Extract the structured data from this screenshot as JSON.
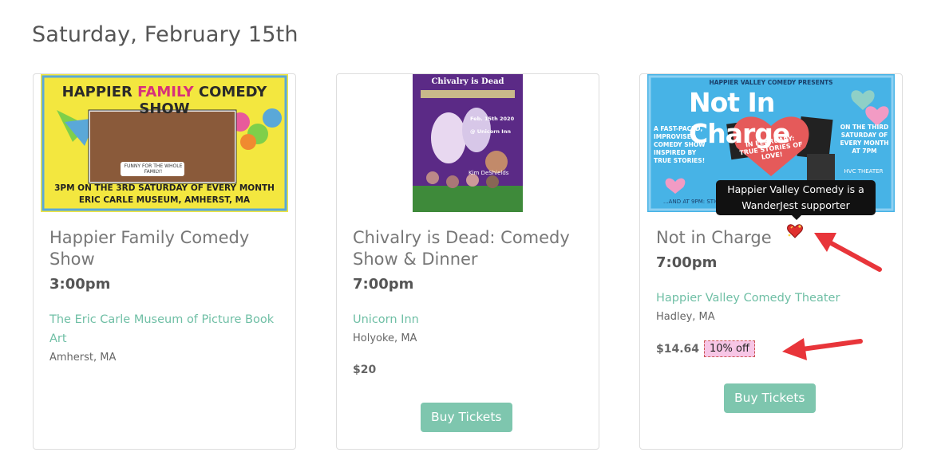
{
  "page": {
    "date_heading": "Saturday, February 15th"
  },
  "events": [
    {
      "title": "Happier Family Comedy Show",
      "time": "3:00pm",
      "venue": "The Eric Carle Museum of Picture Book Art",
      "city": "Amherst, MA",
      "poster": {
        "banner": "HAPPIER FAMILY COMEDY SHOW",
        "banner_word_family": "FAMILY",
        "tagline": "FUNNY FOR THE WHOLE FAMILY!",
        "schedule": "3PM ON THE 3RD SATURDAY OF EVERY MONTH",
        "location": "ERIC CARLE MUSEUM, AMHERST, MA"
      }
    },
    {
      "title": "Chivalry is Dead: Comedy Show & Dinner",
      "time": "7:00pm",
      "venue": "Unicorn Inn",
      "city": "Holyoke, MA",
      "price": "$20",
      "buy_label": "Buy Tickets",
      "poster": {
        "banner": "Chivalry is Dead",
        "date": "Feb. 15th 2020",
        "place": "@ Unicorn Inn",
        "headliner": "Kim DeShields"
      }
    },
    {
      "title": "Not in Charge",
      "time": "7:00pm",
      "venue": "Happier Valley Comedy Theater",
      "city": "Hadley, MA",
      "price": "$14.64",
      "discount": "10% off",
      "buy_label": "Buy Tickets",
      "supporter_tooltip": "Happier Valley Comedy is a WanderJest supporter",
      "poster": {
        "presents": "HAPPIER VALLEY COMEDY PRESENTS",
        "banner": "Not In Charge",
        "blurb": "A FAST-PACED, IMPROVISED COMEDY SHOW INSPIRED BY TRUE STORIES!",
        "heart_text": "IN FEBRUARY: TRUE STORIES OF LOVE!",
        "schedule": "ON THE THIRD SATURDAY OF EVERY MONTH AT 7PM",
        "venue": "HVC THEATER",
        "footer": "...AND AT 9PM: STICK"
      }
    }
  ],
  "colors": {
    "accent": "#7ec6ae",
    "link": "#6fbfa5",
    "discount_bg": "#f7c6e6",
    "arrow": "#e8353a"
  },
  "icons": {
    "supporter": "sparkling-heart-icon",
    "annotation": "red-arrow"
  }
}
